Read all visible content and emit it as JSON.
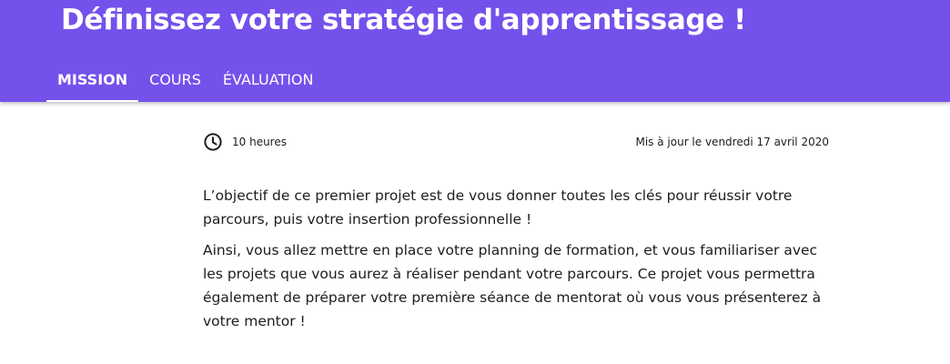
{
  "header": {
    "title": "Définissez votre stratégie d'apprentissage !",
    "background_color": "#7451eb",
    "tabs": [
      {
        "label": "MISSION",
        "active": true
      },
      {
        "label": "COURS",
        "active": false
      },
      {
        "label": "ÉVALUATION",
        "active": false
      }
    ]
  },
  "meta": {
    "duration_icon": "clock-icon",
    "duration": "10 heures",
    "updated": "Mis à jour le vendredi 17 avril 2020"
  },
  "content": {
    "paragraphs": [
      "L’objectif de ce premier projet est de vous donner toutes les clés pour réussir votre parcours, puis votre insertion professionnelle !",
      "Ainsi, vous allez mettre en place votre planning de formation, et vous familiariser avec les projets que vous aurez à réaliser pendant votre parcours. Ce projet vous permettra également de préparer votre première séance de mentorat où vous vous présenterez à votre mentor !"
    ]
  }
}
